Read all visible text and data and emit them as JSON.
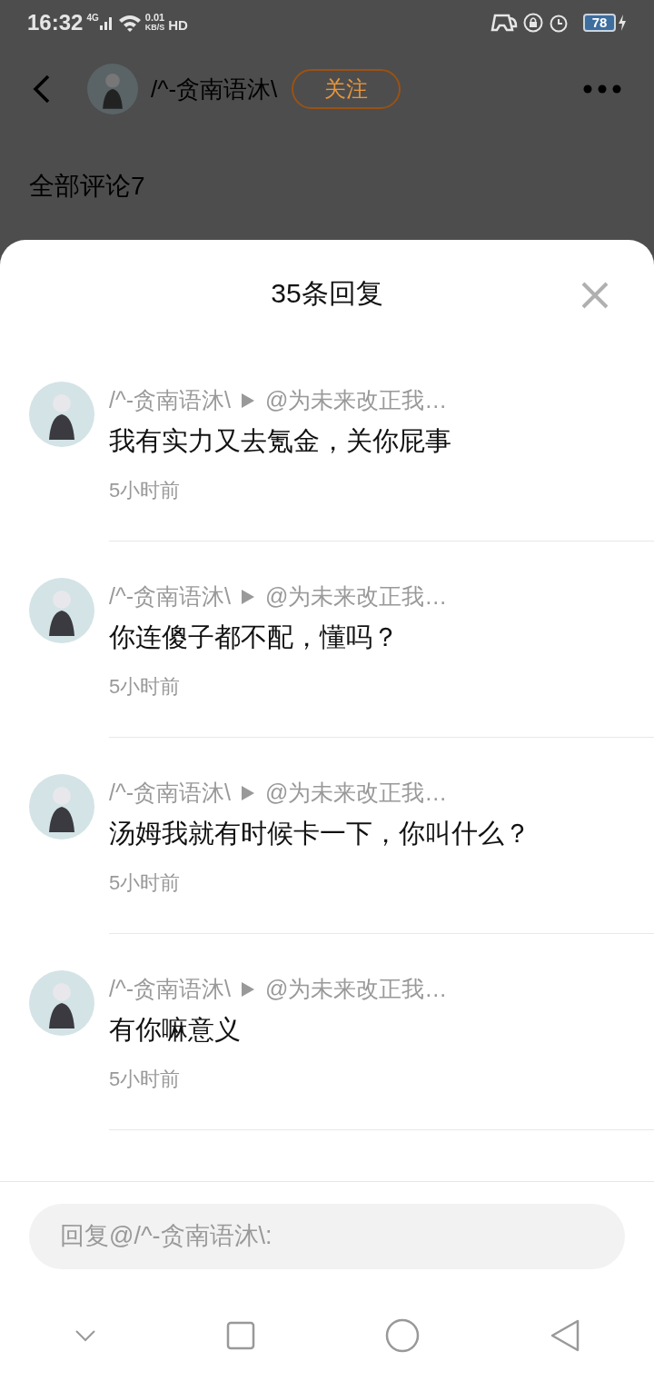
{
  "status_bar": {
    "time": "16:32",
    "network": "4G",
    "speed": "0.01",
    "speed_unit": "KB/S",
    "hd": "HD",
    "battery": "78"
  },
  "header": {
    "title": "/^-贪南语沐\\",
    "follow_button": "关注"
  },
  "comments_heading": "全部评论7",
  "sheet": {
    "title": "35条回复",
    "replies": [
      {
        "name": "/^-贪南语沐\\",
        "target": "@为未来改正我…",
        "content": "我有实力又去氪金，关你屁事",
        "time": "5小时前"
      },
      {
        "name": "/^-贪南语沐\\",
        "target": "@为未来改正我…",
        "content": "你连傻子都不配，懂吗？",
        "time": "5小时前"
      },
      {
        "name": "/^-贪南语沐\\",
        "target": "@为未来改正我…",
        "content": "汤姆我就有时候卡一下，你叫什么？",
        "time": "5小时前"
      },
      {
        "name": "/^-贪南语沐\\",
        "target": "@为未来改正我…",
        "content": "有你嘛意义",
        "time": "5小时前"
      }
    ],
    "reply_input": {
      "placeholder": "回复@/^-贪南语沐\\:"
    }
  }
}
